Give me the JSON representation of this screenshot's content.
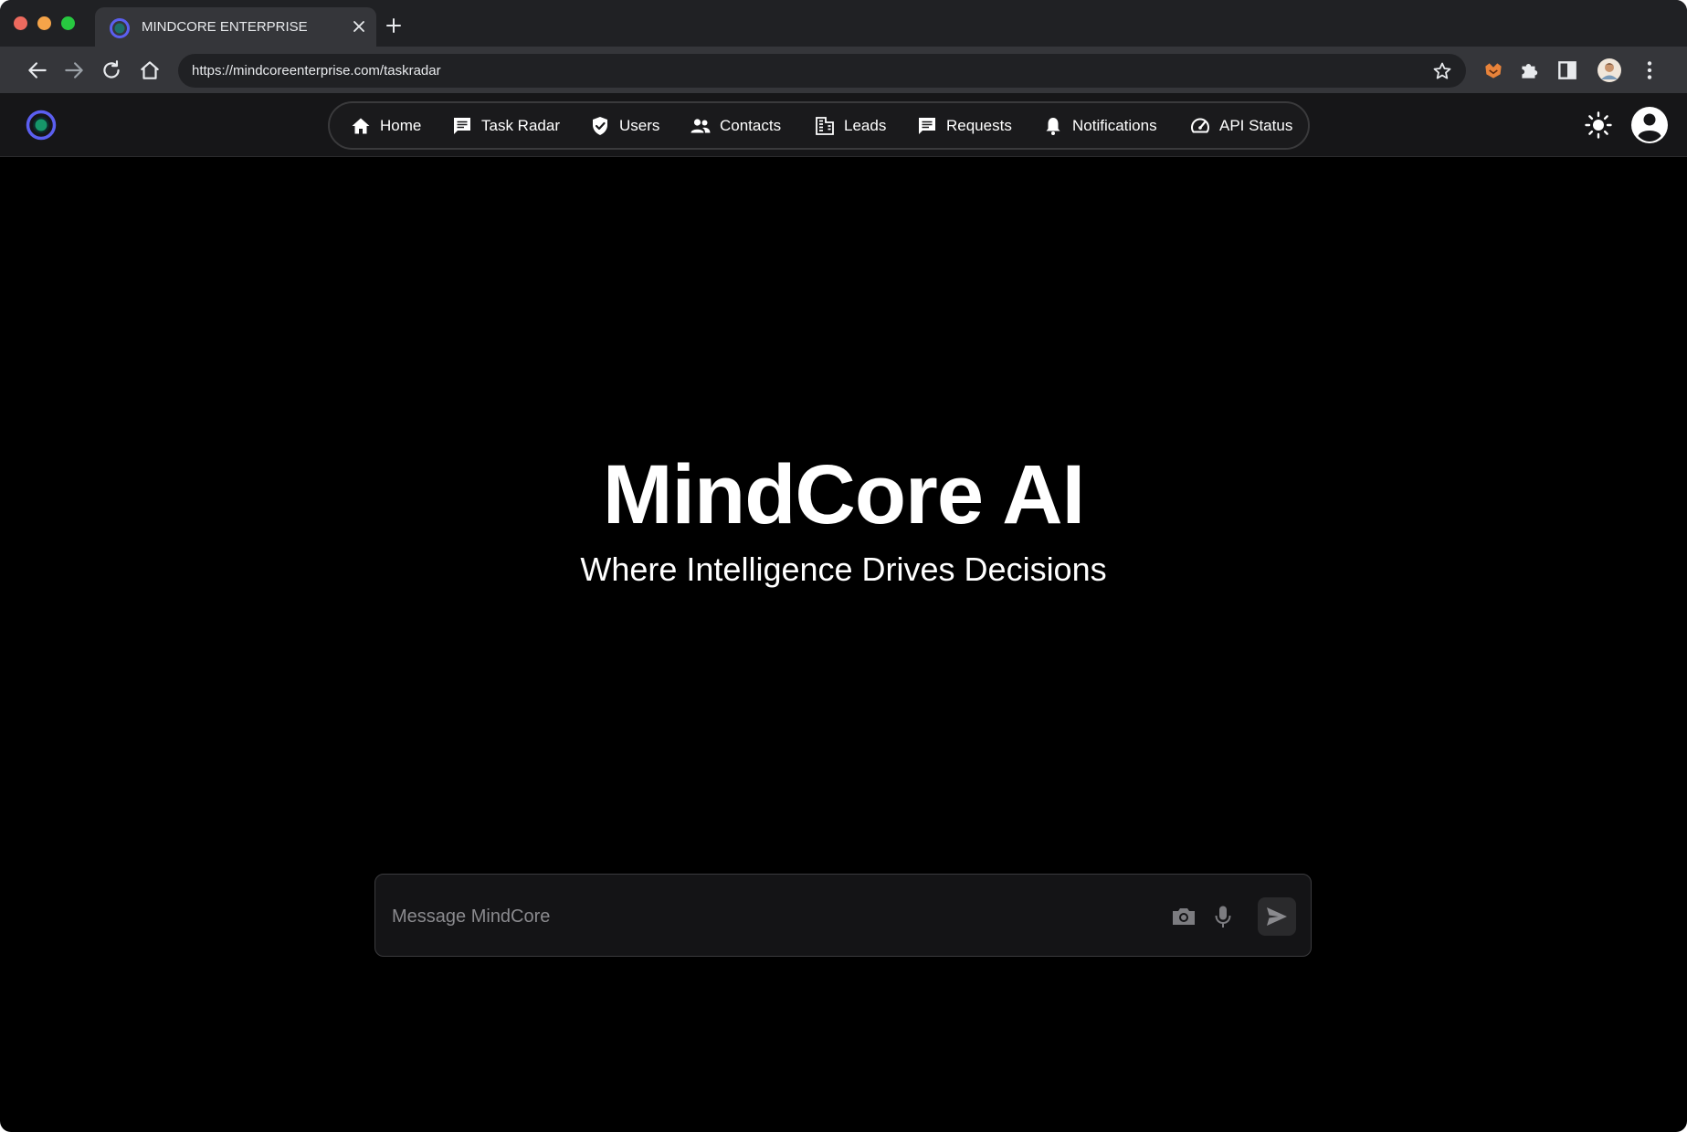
{
  "browser": {
    "tab_title": "MINDCORE ENTERPRISE",
    "url": "https://mindcoreenterprise.com/taskradar"
  },
  "nav": {
    "items": [
      {
        "label": "Home",
        "icon": "home-icon"
      },
      {
        "label": "Task Radar",
        "icon": "chat-bubble-icon"
      },
      {
        "label": "Users",
        "icon": "shield-check-icon"
      },
      {
        "label": "Contacts",
        "icon": "people-icon"
      },
      {
        "label": "Leads",
        "icon": "building-icon"
      },
      {
        "label": "Requests",
        "icon": "message-icon"
      },
      {
        "label": "Notifications",
        "icon": "bell-icon"
      },
      {
        "label": "API Status",
        "icon": "speedometer-icon"
      }
    ]
  },
  "hero": {
    "title": "MindCore AI",
    "subtitle": "Where Intelligence Drives Decisions"
  },
  "composer": {
    "placeholder": "Message MindCore"
  },
  "colors": {
    "page_background": "#000000",
    "logo_ring": "#5b5ff0",
    "logo_core": "#19a974"
  }
}
